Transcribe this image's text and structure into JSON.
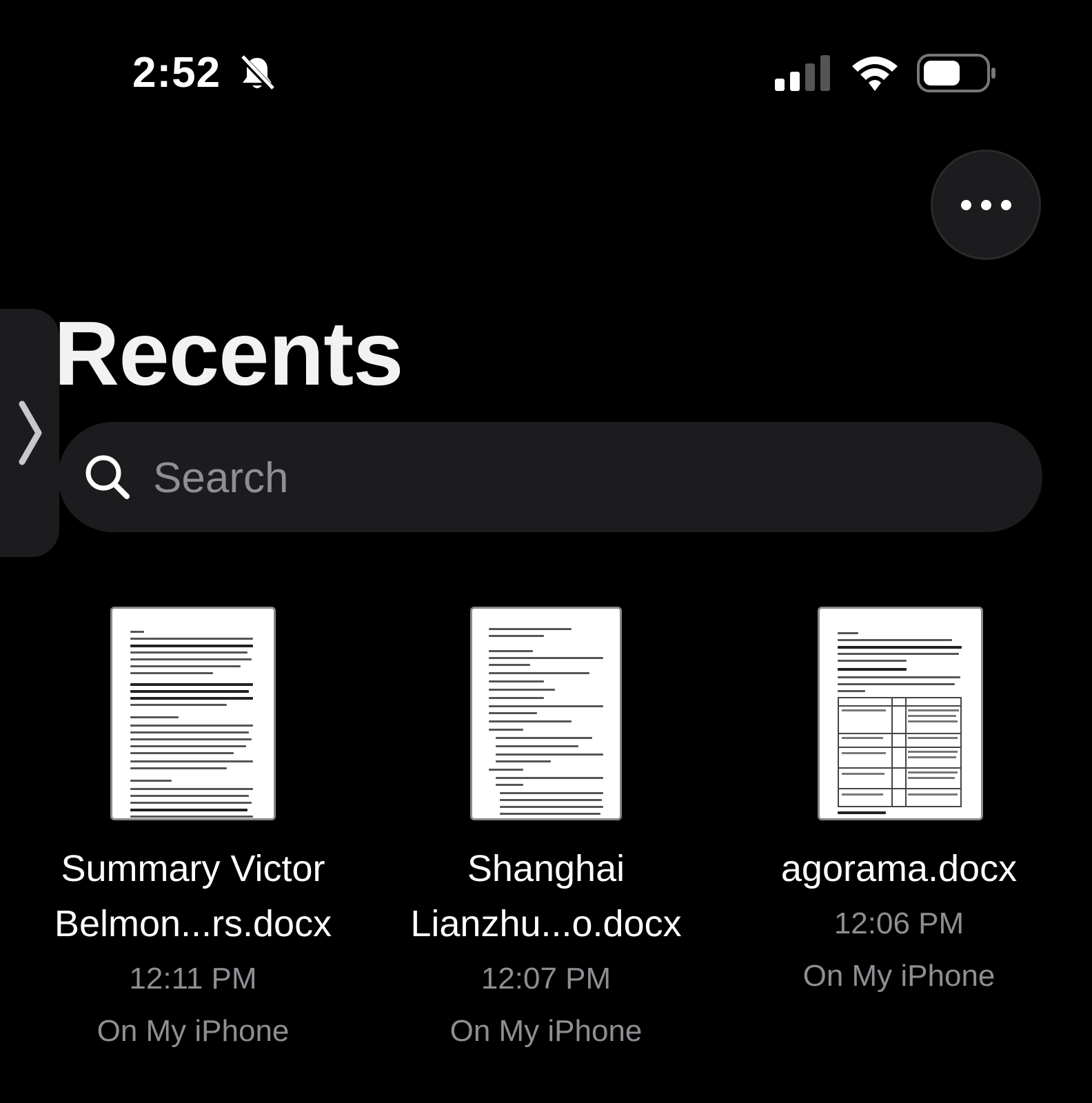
{
  "status_bar": {
    "time": "2:52",
    "icons": [
      "bell-slash-icon",
      "cellular-signal-icon",
      "wifi-icon",
      "battery-icon"
    ]
  },
  "header": {
    "more_icon": "ellipsis-icon",
    "title": "Recents"
  },
  "search": {
    "placeholder": "Search",
    "icon": "search-icon"
  },
  "files": [
    {
      "name_line1": "Summary Victor",
      "name_line2": "Belmon...rs.docx",
      "time": "12:11 PM",
      "location": "On My iPhone"
    },
    {
      "name_line1": "Shanghai",
      "name_line2": "Lianzhu...o.docx",
      "time": "12:07 PM",
      "location": "On My iPhone"
    },
    {
      "name_line1": "agorama.docx",
      "name_line2": "",
      "time": "12:06 PM",
      "location": "On My iPhone"
    }
  ],
  "colors": {
    "background": "#000000",
    "surface": "#1c1c1e",
    "secondary_text": "#8e8e93"
  }
}
